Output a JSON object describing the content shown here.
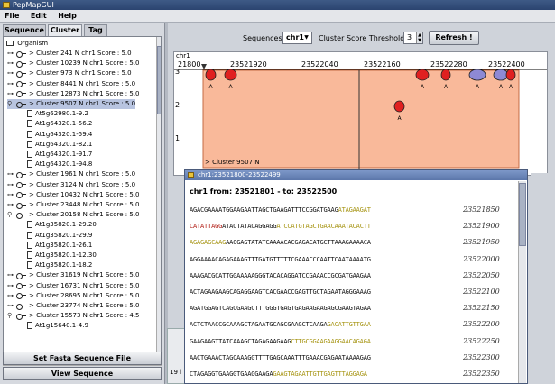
{
  "window": {
    "title": "PepMapGUI"
  },
  "menu": [
    "File",
    "Edit",
    "Help"
  ],
  "tabs": [
    "Sequence",
    "Cluster",
    "Tag"
  ],
  "tree": {
    "root": "Organism",
    "rows": [
      {
        "kind": "cluster",
        "expanded": false,
        "label": "Cluster 241 N chr1 Score : 5.0"
      },
      {
        "kind": "cluster",
        "expanded": false,
        "label": "Cluster 10239 N chr1 Score : 5.0"
      },
      {
        "kind": "cluster",
        "expanded": false,
        "label": "Cluster 973 N chr1 Score : 5.0"
      },
      {
        "kind": "cluster",
        "expanded": false,
        "label": "Cluster 8441 N chr1 Score : 5.0"
      },
      {
        "kind": "cluster",
        "expanded": false,
        "label": "Cluster 12873 N chr1 Score : 5.0"
      },
      {
        "kind": "cluster",
        "expanded": true,
        "selected": true,
        "label": "Cluster 9507 N chr1 Score : 5.0"
      },
      {
        "kind": "leaf",
        "label": "At5g62980.1-9.2"
      },
      {
        "kind": "leaf",
        "label": "At1g64320.1-56.2"
      },
      {
        "kind": "leaf",
        "label": "At1g64320.1-59.4"
      },
      {
        "kind": "leaf",
        "label": "At1g64320.1-82.1"
      },
      {
        "kind": "leaf",
        "label": "At1g64320.1-91.7"
      },
      {
        "kind": "leaf",
        "label": "At1g64320.1-94.8"
      },
      {
        "kind": "cluster",
        "expanded": false,
        "label": "Cluster 1961 N chr1 Score : 5.0"
      },
      {
        "kind": "cluster",
        "expanded": false,
        "label": "Cluster 3124 N chr1 Score : 5.0"
      },
      {
        "kind": "cluster",
        "expanded": false,
        "label": "Cluster 10432 N chr1 Score : 5.0"
      },
      {
        "kind": "cluster",
        "expanded": false,
        "label": "Cluster 23448 N chr1 Score : 5.0"
      },
      {
        "kind": "cluster",
        "expanded": true,
        "label": "Cluster 20158 N chr1 Score : 5.0"
      },
      {
        "kind": "leaf",
        "label": "At1g35820.1-29.20"
      },
      {
        "kind": "leaf",
        "label": "At1g35820.1-29.9"
      },
      {
        "kind": "leaf",
        "label": "At1g35820.1-26.1"
      },
      {
        "kind": "leaf",
        "label": "At1g35820.1-12.30"
      },
      {
        "kind": "leaf",
        "label": "At1g35820.1-18.2"
      },
      {
        "kind": "cluster",
        "expanded": false,
        "label": "Cluster 31619 N chr1 Score : 5.0"
      },
      {
        "kind": "cluster",
        "expanded": false,
        "label": "Cluster 16731 N chr1 Score : 5.0"
      },
      {
        "kind": "cluster",
        "expanded": false,
        "label": "Cluster 28695 N chr1 Score : 5.0"
      },
      {
        "kind": "cluster",
        "expanded": false,
        "label": "Cluster 23774 N chr1 Score : 5.0"
      },
      {
        "kind": "cluster",
        "expanded": true,
        "label": "Cluster 15573 N chr1 Score : 4.5"
      },
      {
        "kind": "leaf",
        "label": "At1g15640.1-4.9"
      }
    ]
  },
  "buttons": {
    "set_fasta": "Set Fasta Sequence File",
    "view_sequence": "View Sequence",
    "refresh": "Refresh !"
  },
  "toolbar": {
    "sequences_label": "Sequences :",
    "sequence_value": "chr1",
    "threshold_label": "Cluster Score Threshold :",
    "threshold_value": "3"
  },
  "plot": {
    "chrom_label": "chr1",
    "ticks": [
      "21800",
      "23521920",
      "23522040",
      "23522160",
      "23522280",
      "23522400"
    ],
    "y_labels": [
      "3",
      "2",
      "1"
    ],
    "cluster_label": "Cluster 9507 N",
    "peptide_letter": "A",
    "colors": {
      "cluster_fill": "#f9b99a",
      "cluster_border": "#c46b44",
      "peptide_red": "#e02020",
      "peptide_purple": "#8e89d4"
    }
  },
  "subwindow": {
    "title": "chr1:23521800-23522499",
    "range": "chr1 from: 23521801 - to: 23522500",
    "rows": [
      {
        "segments": [
          {
            "t": "AGACGAAAATGGAAGAATTAGCTGAAGATTTCCGGATGAAG",
            "c": "n"
          },
          {
            "t": "ATAGAAGAT",
            "c": "o"
          }
        ],
        "pos": "23521850"
      },
      {
        "segments": [
          {
            "t": "CATATTAGG",
            "c": "r"
          },
          {
            "t": "ATACTATACAGGAGG",
            "c": "n"
          },
          {
            "t": "ATCCATGTAGCTGAACAAATACACTT",
            "c": "o"
          }
        ],
        "pos": "23521900"
      },
      {
        "segments": [
          {
            "t": "AGAGAGCAAG",
            "c": "o"
          },
          {
            "t": "AACGAGTATATCAAAACACGAGACATGCTTAAAGAAAACA",
            "c": "n"
          }
        ],
        "pos": "23521950"
      },
      {
        "segments": [
          {
            "t": "AGGAAAACAGAGAAAGTTTGATGTTTTTCGAAACCCAATTCAATAAAATG",
            "c": "n"
          }
        ],
        "pos": "23522000"
      },
      {
        "segments": [
          {
            "t": "AAAGACGCATTGGAAAAAGGGTACACAGGATCCGAAACCGCGATGAAGAA",
            "c": "n"
          }
        ],
        "pos": "23522050"
      },
      {
        "segments": [
          {
            "t": "ACTAGAAGAAGCAGAGGAAGTCACGAACCGAGTTGCTAGAATAGGGAAAG",
            "c": "n"
          }
        ],
        "pos": "23522100"
      },
      {
        "segments": [
          {
            "t": "AGATGGAGTCAGCGAAGCTTTGGGTGAGTGAGAAGAAGAGCGAAGTAGAA",
            "c": "n"
          }
        ],
        "pos": "23522150"
      },
      {
        "segments": [
          {
            "t": "ACTCTAACCGCAAAGCTAGAATGCAGCGAAGCTCAAGA",
            "c": "n"
          },
          {
            "t": "GACATTGTTGAA",
            "c": "o"
          }
        ],
        "pos": "23522200"
      },
      {
        "segments": [
          {
            "t": "GAAGAAGTTATCAAAGCTAGAGAAGAAG",
            "c": "n"
          },
          {
            "t": "CTTGCGGAAGAAGGAACAGAGA",
            "c": "o"
          }
        ],
        "pos": "23522250"
      },
      {
        "segments": [
          {
            "t": "AACTGAAACTAGCAAAGGTTTTGAGCAAATTTGAAACGAGAATAAAAGAG",
            "c": "n"
          }
        ],
        "pos": "23522300"
      },
      {
        "segments": [
          {
            "t": "CTAGAGGTGAAGGTGAAGGAAGA",
            "c": "n"
          },
          {
            "t": "GAAGTAGAATTGTTGAGTTTAGGAGA",
            "c": "o"
          }
        ],
        "pos": "23522350"
      }
    ]
  },
  "status": {
    "bottom_left": "19 i"
  }
}
